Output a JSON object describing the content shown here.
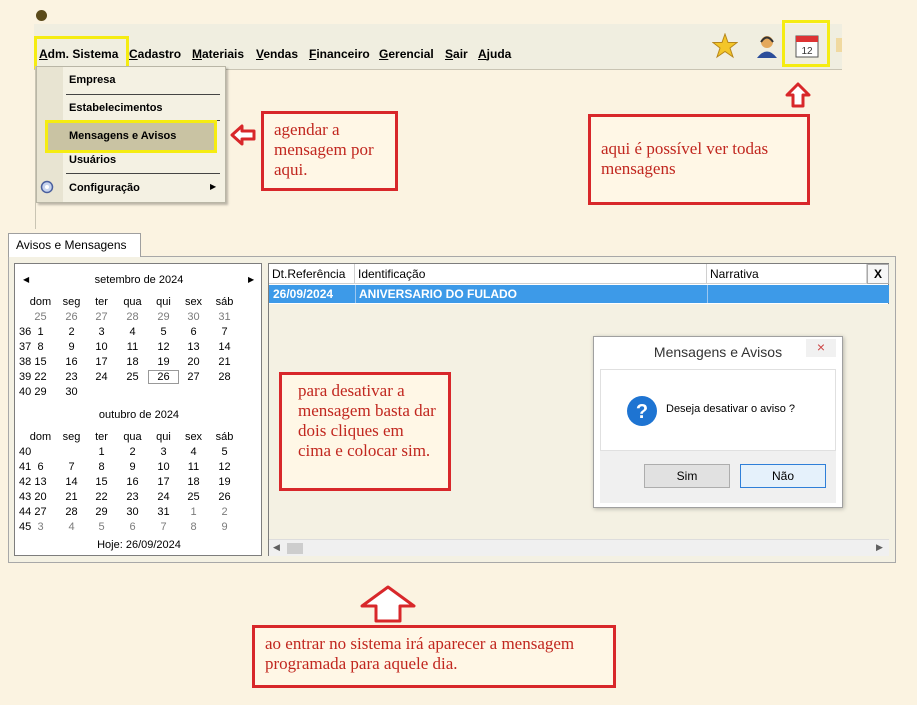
{
  "menubar": {
    "items": [
      {
        "label": "Adm. Sistema",
        "key": "A"
      },
      {
        "label": "Cadastro",
        "key": "C"
      },
      {
        "label": "Materiais",
        "key": "M"
      },
      {
        "label": "Vendas",
        "key": "V"
      },
      {
        "label": "Financeiro",
        "key": "F"
      },
      {
        "label": "Gerencial",
        "key": "G"
      },
      {
        "label": "Sair",
        "key": "S"
      },
      {
        "label": "Ajuda",
        "key": "A"
      }
    ],
    "toolbar_icons": [
      "star-icon",
      "user-support-icon",
      "calendar-icon"
    ]
  },
  "dropdown": {
    "items": [
      {
        "label": "Empresa"
      },
      {
        "label": "Estabelecimentos"
      },
      {
        "label": "Mensagens e Avisos"
      },
      {
        "label": "Usuários"
      },
      {
        "label": "Configuração"
      }
    ]
  },
  "notes": {
    "agendar": "agendar a mensagem por aqui.",
    "ver_todas": "aqui é possível ver todas mensagens",
    "desativar": "para desativar a mensagem basta dar dois cliques em cima e colocar sim.",
    "ao_entrar": "ao entrar no sistema irá aparecer a mensagem programada para aquele dia."
  },
  "tab": {
    "label": "Avisos e Mensagens"
  },
  "calendar": {
    "weekdays": [
      "dom",
      "seg",
      "ter",
      "qua",
      "qui",
      "sex",
      "sáb"
    ],
    "months": [
      {
        "title": "setembro de 2024",
        "weeks": [
          {
            "wk": "",
            "days": [
              "25",
              "26",
              "27",
              "28",
              "29",
              "30",
              "31"
            ]
          },
          {
            "wk": "36",
            "days": [
              "1",
              "2",
              "3",
              "4",
              "5",
              "6",
              "7"
            ]
          },
          {
            "wk": "37",
            "days": [
              "8",
              "9",
              "10",
              "11",
              "12",
              "13",
              "14"
            ]
          },
          {
            "wk": "38",
            "days": [
              "15",
              "16",
              "17",
              "18",
              "19",
              "20",
              "21"
            ]
          },
          {
            "wk": "39",
            "days": [
              "22",
              "23",
              "24",
              "25",
              "26",
              "27",
              "28"
            ]
          },
          {
            "wk": "40",
            "days": [
              "29",
              "30",
              "",
              "",
              "",
              "",
              ""
            ]
          }
        ]
      },
      {
        "title": "outubro de 2024",
        "weeks": [
          {
            "wk": "40",
            "days": [
              "",
              "",
              "1",
              "2",
              "3",
              "4",
              "5"
            ]
          },
          {
            "wk": "41",
            "days": [
              "6",
              "7",
              "8",
              "9",
              "10",
              "11",
              "12"
            ]
          },
          {
            "wk": "42",
            "days": [
              "13",
              "14",
              "15",
              "16",
              "17",
              "18",
              "19"
            ]
          },
          {
            "wk": "43",
            "days": [
              "20",
              "21",
              "22",
              "23",
              "24",
              "25",
              "26"
            ]
          },
          {
            "wk": "44",
            "days": [
              "27",
              "28",
              "29",
              "30",
              "31",
              "1",
              "2"
            ]
          },
          {
            "wk": "45",
            "days": [
              "3",
              "4",
              "5",
              "6",
              "7",
              "8",
              "9"
            ]
          }
        ]
      }
    ],
    "today_label": "Hoje: 26/09/2024"
  },
  "grid": {
    "columns": [
      "Dt.Referência",
      "Identificação",
      "Narrativa"
    ],
    "close_label": "X",
    "rows": [
      {
        "date": "26/09/2024",
        "identificacao": "ANIVERSARIO DO FULADO",
        "narrativa": ""
      }
    ]
  },
  "dialog": {
    "title": "Mensagens e Avisos",
    "message": "Deseja desativar o aviso ?",
    "yes": "Sim",
    "no": "Não",
    "close": "×"
  },
  "colors": {
    "annotation_red": "#d8272a",
    "highlight_yellow": "#f5ec12",
    "selection_blue": "#3d9ae8"
  }
}
